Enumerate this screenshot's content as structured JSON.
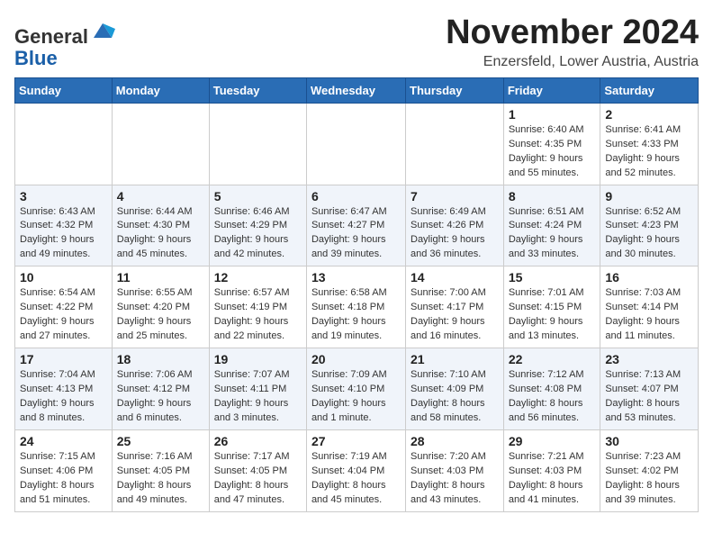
{
  "header": {
    "logo": {
      "line1": "General",
      "line2": "Blue"
    },
    "title": "November 2024",
    "location": "Enzersfeld, Lower Austria, Austria"
  },
  "weekdays": [
    "Sunday",
    "Monday",
    "Tuesday",
    "Wednesday",
    "Thursday",
    "Friday",
    "Saturday"
  ],
  "weeks": [
    [
      {
        "day": "",
        "info": ""
      },
      {
        "day": "",
        "info": ""
      },
      {
        "day": "",
        "info": ""
      },
      {
        "day": "",
        "info": ""
      },
      {
        "day": "",
        "info": ""
      },
      {
        "day": "1",
        "info": "Sunrise: 6:40 AM\nSunset: 4:35 PM\nDaylight: 9 hours and 55 minutes."
      },
      {
        "day": "2",
        "info": "Sunrise: 6:41 AM\nSunset: 4:33 PM\nDaylight: 9 hours and 52 minutes."
      }
    ],
    [
      {
        "day": "3",
        "info": "Sunrise: 6:43 AM\nSunset: 4:32 PM\nDaylight: 9 hours and 49 minutes."
      },
      {
        "day": "4",
        "info": "Sunrise: 6:44 AM\nSunset: 4:30 PM\nDaylight: 9 hours and 45 minutes."
      },
      {
        "day": "5",
        "info": "Sunrise: 6:46 AM\nSunset: 4:29 PM\nDaylight: 9 hours and 42 minutes."
      },
      {
        "day": "6",
        "info": "Sunrise: 6:47 AM\nSunset: 4:27 PM\nDaylight: 9 hours and 39 minutes."
      },
      {
        "day": "7",
        "info": "Sunrise: 6:49 AM\nSunset: 4:26 PM\nDaylight: 9 hours and 36 minutes."
      },
      {
        "day": "8",
        "info": "Sunrise: 6:51 AM\nSunset: 4:24 PM\nDaylight: 9 hours and 33 minutes."
      },
      {
        "day": "9",
        "info": "Sunrise: 6:52 AM\nSunset: 4:23 PM\nDaylight: 9 hours and 30 minutes."
      }
    ],
    [
      {
        "day": "10",
        "info": "Sunrise: 6:54 AM\nSunset: 4:22 PM\nDaylight: 9 hours and 27 minutes."
      },
      {
        "day": "11",
        "info": "Sunrise: 6:55 AM\nSunset: 4:20 PM\nDaylight: 9 hours and 25 minutes."
      },
      {
        "day": "12",
        "info": "Sunrise: 6:57 AM\nSunset: 4:19 PM\nDaylight: 9 hours and 22 minutes."
      },
      {
        "day": "13",
        "info": "Sunrise: 6:58 AM\nSunset: 4:18 PM\nDaylight: 9 hours and 19 minutes."
      },
      {
        "day": "14",
        "info": "Sunrise: 7:00 AM\nSunset: 4:17 PM\nDaylight: 9 hours and 16 minutes."
      },
      {
        "day": "15",
        "info": "Sunrise: 7:01 AM\nSunset: 4:15 PM\nDaylight: 9 hours and 13 minutes."
      },
      {
        "day": "16",
        "info": "Sunrise: 7:03 AM\nSunset: 4:14 PM\nDaylight: 9 hours and 11 minutes."
      }
    ],
    [
      {
        "day": "17",
        "info": "Sunrise: 7:04 AM\nSunset: 4:13 PM\nDaylight: 9 hours and 8 minutes."
      },
      {
        "day": "18",
        "info": "Sunrise: 7:06 AM\nSunset: 4:12 PM\nDaylight: 9 hours and 6 minutes."
      },
      {
        "day": "19",
        "info": "Sunrise: 7:07 AM\nSunset: 4:11 PM\nDaylight: 9 hours and 3 minutes."
      },
      {
        "day": "20",
        "info": "Sunrise: 7:09 AM\nSunset: 4:10 PM\nDaylight: 9 hours and 1 minute."
      },
      {
        "day": "21",
        "info": "Sunrise: 7:10 AM\nSunset: 4:09 PM\nDaylight: 8 hours and 58 minutes."
      },
      {
        "day": "22",
        "info": "Sunrise: 7:12 AM\nSunset: 4:08 PM\nDaylight: 8 hours and 56 minutes."
      },
      {
        "day": "23",
        "info": "Sunrise: 7:13 AM\nSunset: 4:07 PM\nDaylight: 8 hours and 53 minutes."
      }
    ],
    [
      {
        "day": "24",
        "info": "Sunrise: 7:15 AM\nSunset: 4:06 PM\nDaylight: 8 hours and 51 minutes."
      },
      {
        "day": "25",
        "info": "Sunrise: 7:16 AM\nSunset: 4:05 PM\nDaylight: 8 hours and 49 minutes."
      },
      {
        "day": "26",
        "info": "Sunrise: 7:17 AM\nSunset: 4:05 PM\nDaylight: 8 hours and 47 minutes."
      },
      {
        "day": "27",
        "info": "Sunrise: 7:19 AM\nSunset: 4:04 PM\nDaylight: 8 hours and 45 minutes."
      },
      {
        "day": "28",
        "info": "Sunrise: 7:20 AM\nSunset: 4:03 PM\nDaylight: 8 hours and 43 minutes."
      },
      {
        "day": "29",
        "info": "Sunrise: 7:21 AM\nSunset: 4:03 PM\nDaylight: 8 hours and 41 minutes."
      },
      {
        "day": "30",
        "info": "Sunrise: 7:23 AM\nSunset: 4:02 PM\nDaylight: 8 hours and 39 minutes."
      }
    ]
  ]
}
